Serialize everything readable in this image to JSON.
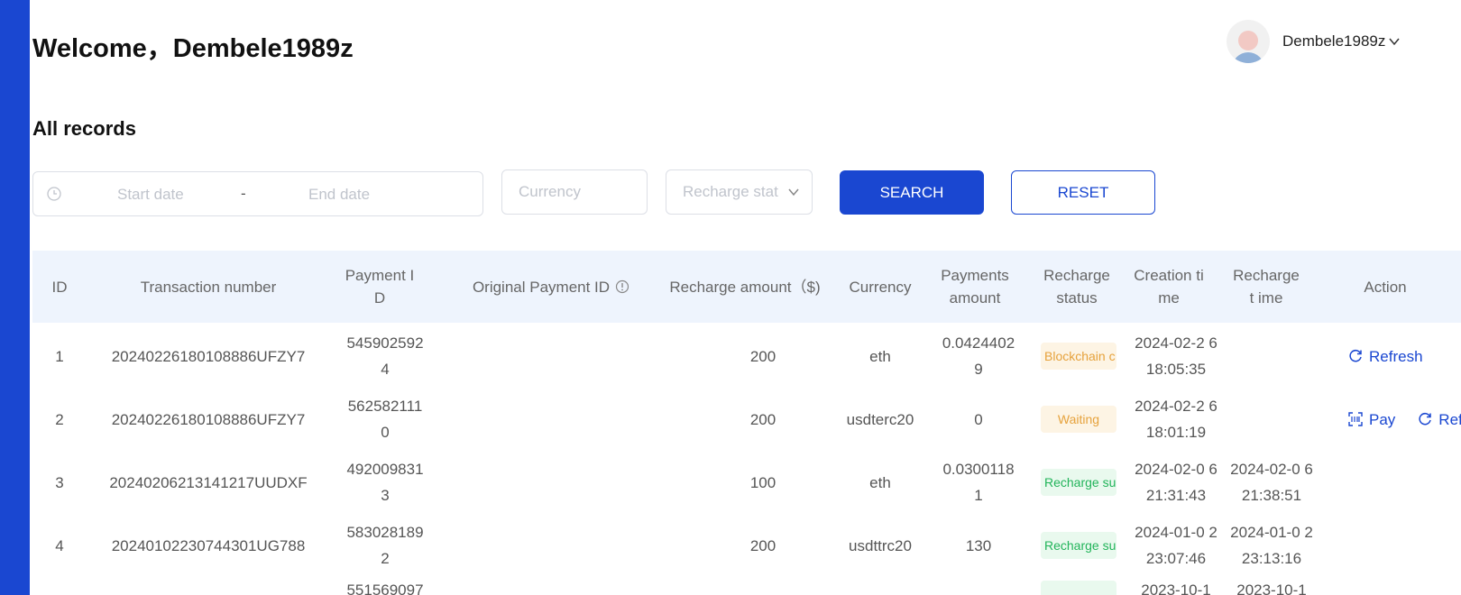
{
  "header": {
    "welcome": "Welcome，Dembele1989z"
  },
  "user": {
    "name": "Dembele1989z"
  },
  "section": {
    "title": "All records"
  },
  "filters": {
    "start_date_placeholder": "Start date",
    "separator": "-",
    "end_date_placeholder": "End date",
    "currency_placeholder": "Currency",
    "status_placeholder": "Recharge stat",
    "search_label": "SEARCH",
    "reset_label": "RESET"
  },
  "table": {
    "columns": {
      "id": "ID",
      "transaction": "Transaction number",
      "payment_id": "Payment I D",
      "original_payment_id": "Original Payment ID",
      "recharge_amount": "Recharge amount（$)",
      "currency": "Currency",
      "payments_amount": "Payments amount",
      "recharge_status": "Recharge status",
      "creation_time": "Creation ti me",
      "recharge_time": "Recharge t ime",
      "action": "Action"
    },
    "rows": [
      {
        "id": "1",
        "transaction": "20240226180108886UFZY7",
        "payment_id": "545902592 4",
        "original_payment_id": "",
        "recharge_amount": "200",
        "currency": "eth",
        "payments_amount": "0.0424402 9",
        "status": "Blockchain c",
        "creation_time": "2024-02-2 6 18:05:35",
        "recharge_time": "",
        "action1": "Refresh",
        "action2": ""
      },
      {
        "id": "2",
        "transaction": "20240226180108886UFZY7",
        "payment_id": "562582111 0",
        "original_payment_id": "",
        "recharge_amount": "200",
        "currency": "usdterc20",
        "payments_amount": "0",
        "status": "Waiting",
        "creation_time": "2024-02-2 6 18:01:19",
        "recharge_time": "",
        "action1": "Pay",
        "action2": "Refresh"
      },
      {
        "id": "3",
        "transaction": "20240206213141217UUDXF",
        "payment_id": "492009831 3",
        "original_payment_id": "",
        "recharge_amount": "100",
        "currency": "eth",
        "payments_amount": "0.0300118 1",
        "status": "Recharge su",
        "creation_time": "2024-02-0 6 21:31:43",
        "recharge_time": "2024-02-0 6 21:38:51",
        "action1": "",
        "action2": ""
      },
      {
        "id": "4",
        "transaction": "20240102230744301UG788",
        "payment_id": "583028189 2",
        "original_payment_id": "",
        "recharge_amount": "200",
        "currency": "usdttrc20",
        "payments_amount": "130",
        "status": "Recharge su",
        "creation_time": "2024-01-0 2 23:07:46",
        "recharge_time": "2024-01-0 2 23:13:16",
        "action1": "",
        "action2": ""
      },
      {
        "id": "",
        "transaction": "",
        "payment_id": "551569097",
        "original_payment_id": "",
        "recharge_amount": "",
        "currency": "",
        "payments_amount": "",
        "status": "",
        "creation_time": "2023-10-1",
        "recharge_time": "2023-10-1",
        "action1": "",
        "action2": ""
      }
    ]
  },
  "colors": {
    "accent": "#1a47d1",
    "header_bg": "#eef4fd",
    "warn": "#e6a23c",
    "success": "#22b45a"
  }
}
